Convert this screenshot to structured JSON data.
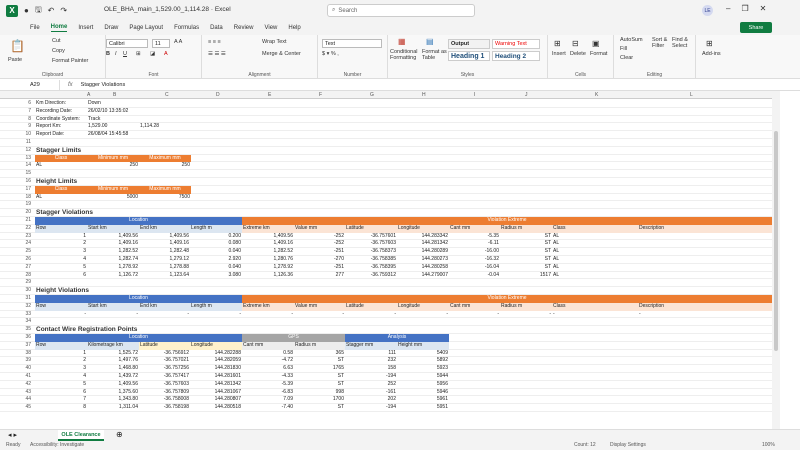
{
  "app": {
    "logo": "X",
    "doc_title": "OLE_BHA_main_1,529.00_1,114.28  ·  Excel",
    "search_placeholder": "Search",
    "user_initials": "LE",
    "share_label": "Share",
    "accent": "#107c41"
  },
  "menu": [
    "File",
    "Home",
    "Insert",
    "Draw",
    "Page Layout",
    "Formulas",
    "Data",
    "Review",
    "View",
    "Help"
  ],
  "menu_active": "Home",
  "ribbon": {
    "paste": "Paste",
    "cut": "Cut",
    "copy": "Copy",
    "format_painter": "Format Painter",
    "clipboard": "Clipboard",
    "font_name": "Calibri",
    "font_size": "11",
    "font": "Font",
    "wrap_text": "Wrap Text",
    "merge_center": "Merge & Center",
    "alignment": "Alignment",
    "number_format": "Text",
    "number": "Number",
    "conditional_formatting": "Conditional Formatting",
    "format_as_table": "Format as Table",
    "styles": "Styles",
    "style_output": "Output",
    "style_warning": "Warning Text",
    "style_h1": "Heading 1",
    "style_h2": "Heading 2",
    "insert": "Insert",
    "delete": "Delete",
    "format": "Format",
    "cells": "Cells",
    "autosum": "AutoSum",
    "fill": "Fill",
    "clear": "Clear",
    "sort_filter": "Sort & Filter",
    "find_select": "Find & Select",
    "editing": "Editing",
    "addins": "Add-ins"
  },
  "formula_bar": {
    "name_box": "A29",
    "fx": "fx",
    "content": "Stagger Violations"
  },
  "columns": [
    "A",
    "B",
    "C",
    "D",
    "E",
    "F",
    "G",
    "H",
    "I",
    "J",
    "K",
    "L"
  ],
  "rows_top": [
    {
      "n": "6",
      "a": "Km Direction:",
      "b": "Down"
    },
    {
      "n": "7",
      "a": "Recording Date:",
      "b": "26/02/10 13:35:02"
    },
    {
      "n": "8",
      "a": "Coordinate System:",
      "b": "Track"
    },
    {
      "n": "9",
      "a": "Report Km:",
      "b": "1,529.00",
      "c": "1,114.28"
    },
    {
      "n": "10",
      "a": "Report Date:",
      "b": "26/08/04 15:45:58"
    }
  ],
  "stagger_limits": {
    "title": "Stagger Limits",
    "headers": [
      "Class",
      "Minimum mm",
      "Maximum mm"
    ],
    "row": [
      "AL",
      "250",
      "250"
    ]
  },
  "height_limits": {
    "title": "Height Limits",
    "headers": [
      "Class",
      "Minimum mm",
      "Maximum mm"
    ],
    "row": [
      "AL",
      "5000",
      "7500"
    ]
  },
  "stagger_violations": {
    "title": "Stagger Violations",
    "group_location": "Location",
    "group_extreme": "Violation Extreme",
    "headers": [
      "Row",
      "Start km",
      "End km",
      "Length m",
      "Extreme km",
      "Value mm",
      "Latitude",
      "Longitude",
      "Cant mm",
      "Radius m",
      "Class",
      "Description"
    ],
    "rows": [
      [
        "1",
        "1,409.56",
        "1,409.56",
        "0.200",
        "1,409.56",
        "-252",
        "-36.757601",
        "144.283342",
        "-5.35",
        "ST",
        "AL",
        ""
      ],
      [
        "2",
        "1,409.16",
        "1,409.16",
        "0.080",
        "1,409.16",
        "-252",
        "-36.757603",
        "144.281342",
        "-6.11",
        "ST",
        "AL",
        ""
      ],
      [
        "3",
        "1,282.52",
        "1,282.48",
        "0.040",
        "1,282.52",
        "-251",
        "-36.758373",
        "144.280289",
        "-16.00",
        "ST",
        "AL",
        ""
      ],
      [
        "4",
        "1,282.74",
        "1,279.12",
        "2.920",
        "1,280.76",
        "-270",
        "-36.758385",
        "144.280273",
        "-16.32",
        "ST",
        "AL",
        ""
      ],
      [
        "5",
        "1,278.92",
        "1,278.88",
        "0.040",
        "1,278.92",
        "-251",
        "-36.758395",
        "144.280258",
        "-16.04",
        "ST",
        "AL",
        ""
      ],
      [
        "6",
        "1,126.72",
        "1,123.64",
        "3.080",
        "1,126.36",
        "277",
        "-36.759312",
        "144.279007",
        "-0.04",
        "1517",
        "AL",
        ""
      ]
    ]
  },
  "height_violations": {
    "title": "Height Violations",
    "group_location": "Location",
    "group_extreme": "Violation Extreme",
    "headers": [
      "Row",
      "Start km",
      "End km",
      "Length m",
      "Extreme km",
      "Value mm",
      "Latitude",
      "Longitude",
      "Cant mm",
      "Radius m",
      "Class",
      "Description"
    ],
    "rows": [
      [
        "-",
        "-",
        "-",
        "-",
        "-",
        "-",
        "-",
        "-",
        "-",
        "-",
        "-",
        "-"
      ]
    ]
  },
  "cwrp": {
    "title": "Contact Wire Registration Points",
    "group_location": "Location",
    "group_gps": "GPS",
    "group_analysis": "Analysis",
    "headers": [
      "Row",
      "Kilometrage km",
      "Latitude",
      "Longitude",
      "Cant mm",
      "Radius m",
      "Stagger mm",
      "Height mm"
    ],
    "rows": [
      [
        "1",
        "1,525.72",
        "-36.756912",
        "144.282288",
        "0.58",
        "365",
        "111",
        "5409"
      ],
      [
        "2",
        "1,497.76",
        "-36.757021",
        "144.282059",
        "-4.72",
        "ST",
        "232",
        "5892"
      ],
      [
        "3",
        "1,468.80",
        "-36.757256",
        "144.281830",
        "6.63",
        "1765",
        "158",
        "5923"
      ],
      [
        "4",
        "1,439.72",
        "-36.757417",
        "144.281601",
        "-4.33",
        "ST",
        "-194",
        "5944"
      ],
      [
        "5",
        "1,409.56",
        "-36.757603",
        "144.281342",
        "-5.39",
        "ST",
        "252",
        "5956"
      ],
      [
        "6",
        "1,375.60",
        "-36.757809",
        "144.281067",
        "-6.83",
        "998",
        "-161",
        "5946"
      ],
      [
        "7",
        "1,343.80",
        "-36.758008",
        "144.280807",
        "7.09",
        "1700",
        "202",
        "5961"
      ],
      [
        "8",
        "1,311.04",
        "-36.758198",
        "144.280518",
        "-7.40",
        "ST",
        "-194",
        "5951"
      ]
    ]
  },
  "row_numbers": [
    "6",
    "7",
    "8",
    "9",
    "10",
    "11",
    "12",
    "13",
    "14",
    "15",
    "16",
    "17",
    "18",
    "19",
    "20",
    "21",
    "22",
    "23",
    "24",
    "25",
    "26",
    "27",
    "28",
    "29",
    "30",
    "31",
    "32",
    "33",
    "34",
    "35",
    "36",
    "37",
    "38",
    "39",
    "40",
    "41",
    "42",
    "43",
    "44",
    "45"
  ],
  "sheet_tab": "OLE Clearance",
  "status": {
    "ready": "Ready",
    "accessibility": "Accessibility: Investigate",
    "count": "Count: 12",
    "display": "Display Settings",
    "zoom": "100%"
  }
}
